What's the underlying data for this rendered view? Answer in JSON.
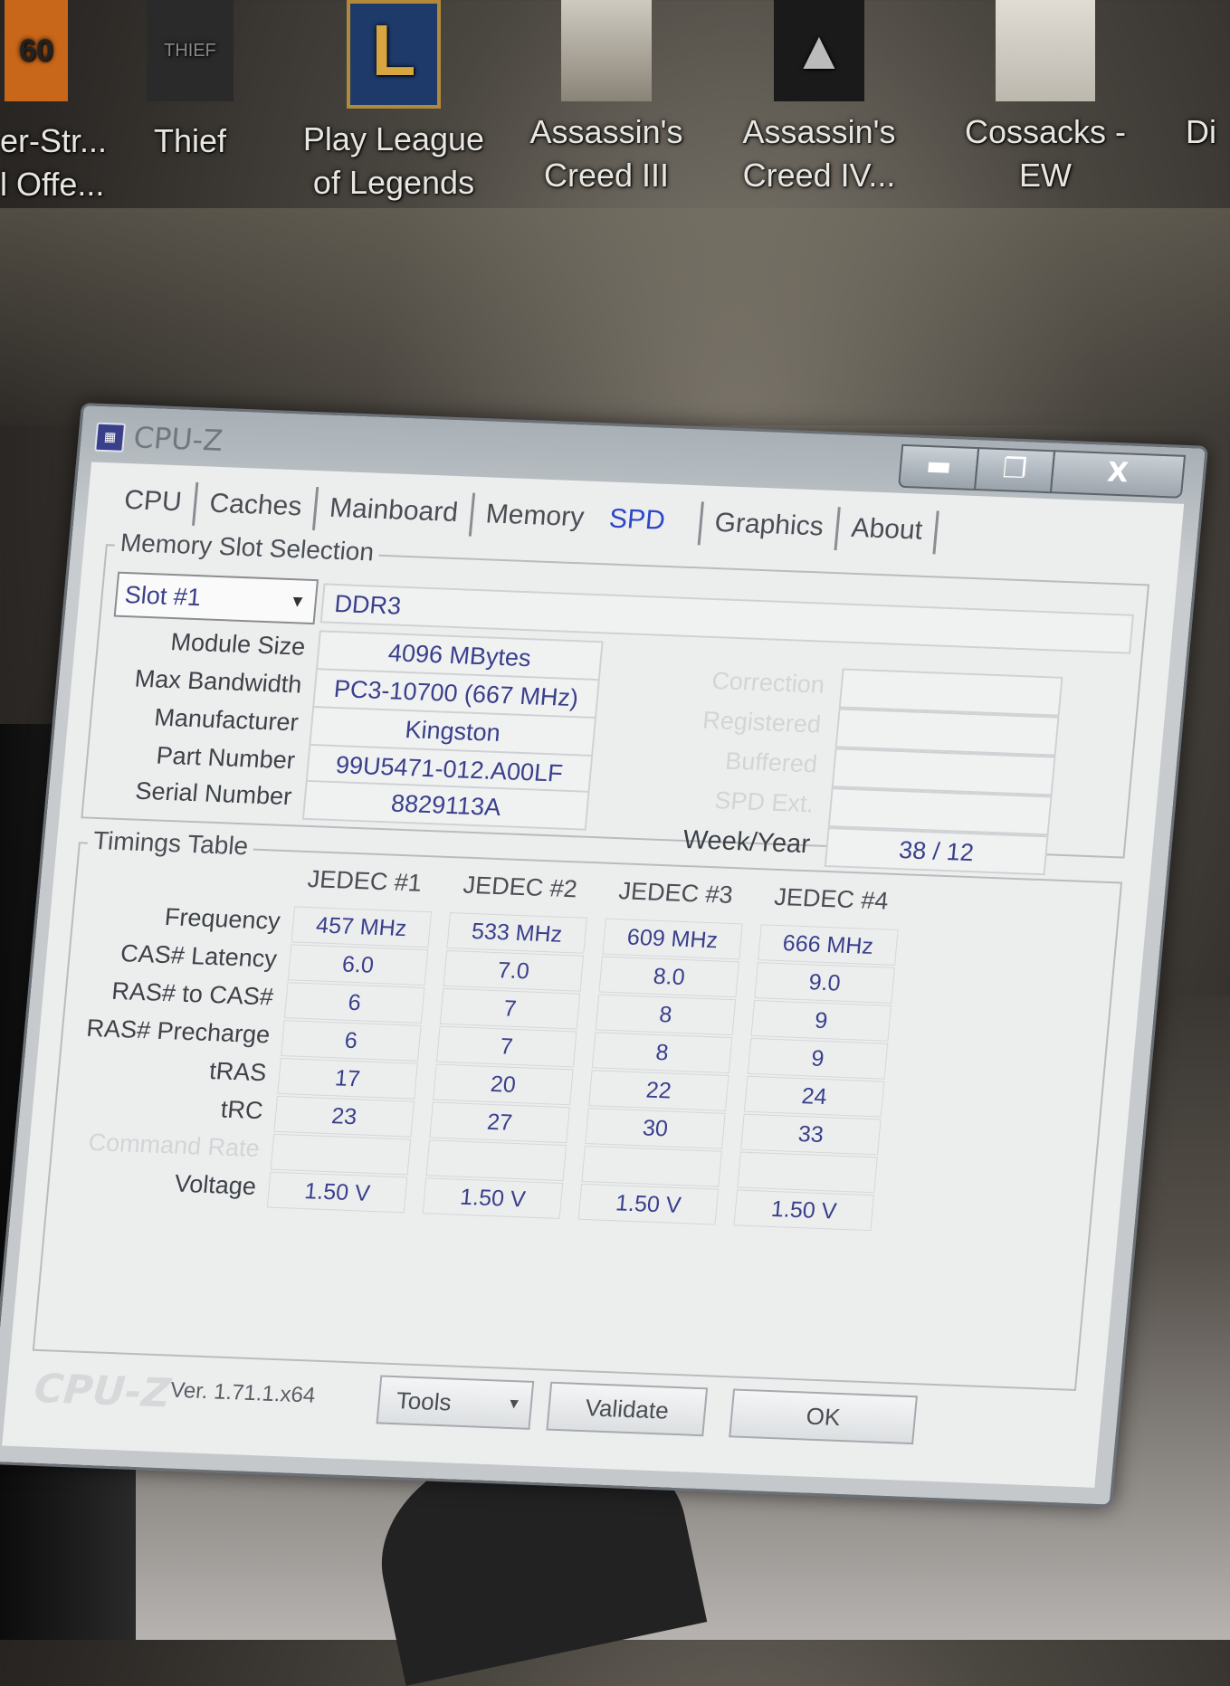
{
  "desktop": {
    "icons": [
      {
        "label": "er-Str...\nl Offe...",
        "thumb": "60",
        "color": "#c8661a"
      },
      {
        "label": "Thief",
        "thumb": "THIEF",
        "color": "#2a2a2a"
      },
      {
        "label": "Play League\nof Legends",
        "thumb": "L",
        "color": "#1d3a6a"
      },
      {
        "label": "Assassin's\nCreed III",
        "thumb": "",
        "color": "#bdb8ae"
      },
      {
        "label": "Assassin's\nCreed IV...",
        "thumb": "",
        "color": "#1a1a1a"
      },
      {
        "label": "Cossacks -\nEW",
        "thumb": "",
        "color": "#d8d4cc"
      },
      {
        "label": "Di",
        "thumb": "",
        "color": "#3a3a3a"
      }
    ]
  },
  "window": {
    "title": "CPU-Z",
    "controls": {
      "min": "▬",
      "max": "❐",
      "close": "X"
    }
  },
  "tabs": [
    "CPU",
    "Caches",
    "Mainboard",
    "Memory",
    "SPD",
    "Graphics",
    "About"
  ],
  "active_tab": "SPD",
  "slot_group": {
    "title": "Memory Slot Selection",
    "slot": "Slot #1",
    "type": "DDR3",
    "labels": {
      "module_size": "Module Size",
      "max_bandwidth": "Max Bandwidth",
      "manufacturer": "Manufacturer",
      "part_number": "Part Number",
      "serial_number": "Serial Number",
      "correction": "Correction",
      "registered": "Registered",
      "buffered": "Buffered",
      "spd_ext": "SPD Ext.",
      "week_year": "Week/Year"
    },
    "values": {
      "module_size": "4096 MBytes",
      "max_bandwidth": "PC3-10700 (667 MHz)",
      "manufacturer": "Kingston",
      "part_number": "99U5471-012.A00LF",
      "serial_number": "8829113A",
      "week_year": "38 / 12"
    }
  },
  "timings": {
    "title": "Timings Table",
    "columns": [
      "JEDEC #1",
      "JEDEC #2",
      "JEDEC #3",
      "JEDEC #4"
    ],
    "rows": [
      {
        "label": "Frequency",
        "values": [
          "457 MHz",
          "533 MHz",
          "609 MHz",
          "666 MHz"
        ]
      },
      {
        "label": "CAS# Latency",
        "values": [
          "6.0",
          "7.0",
          "8.0",
          "9.0"
        ]
      },
      {
        "label": "RAS# to CAS#",
        "values": [
          "6",
          "7",
          "8",
          "9"
        ]
      },
      {
        "label": "RAS# Precharge",
        "values": [
          "6",
          "7",
          "8",
          "9"
        ]
      },
      {
        "label": "tRAS",
        "values": [
          "17",
          "20",
          "22",
          "24"
        ]
      },
      {
        "label": "tRC",
        "values": [
          "23",
          "27",
          "30",
          "33"
        ]
      },
      {
        "label": "Command Rate",
        "values": [
          "",
          "",
          "",
          ""
        ]
      },
      {
        "label": "Voltage",
        "values": [
          "1.50 V",
          "1.50 V",
          "1.50 V",
          "1.50 V"
        ]
      }
    ]
  },
  "footer": {
    "logo": "CPU-Z",
    "version": "Ver. 1.71.1.x64",
    "tools": "Tools",
    "validate": "Validate",
    "ok": "OK"
  }
}
